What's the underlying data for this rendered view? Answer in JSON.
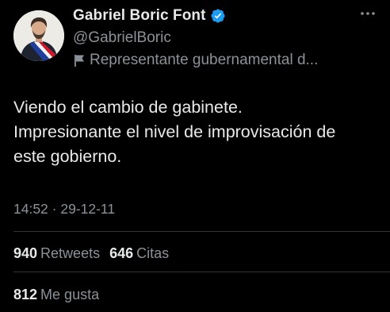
{
  "author": {
    "display_name": "Gabriel Boric Font",
    "handle": "@GabrielBoric",
    "affiliation_label": "Representante gubernamental d...",
    "verified_badge_color": "#1d9bf0"
  },
  "tweet": {
    "text_lines": [
      "Viendo el cambio de gabinete.",
      "Impresionante el nivel de improvisación de",
      "este gobierno."
    ],
    "timestamp": "14:52 · 29-12-11"
  },
  "stats": {
    "retweets_count": "940",
    "retweets_label": "Retweets",
    "quotes_count": "646",
    "quotes_label": "Citas",
    "likes_count": "812",
    "likes_label": "Me gusta"
  },
  "icons": {
    "verified": "verified-badge-icon",
    "affiliation": "flag-icon",
    "more": "more-options-icon"
  },
  "colors": {
    "background": "#000000",
    "primary_text": "#e7e9ea",
    "secondary_text": "#8b9198",
    "divider": "#2f3336"
  }
}
